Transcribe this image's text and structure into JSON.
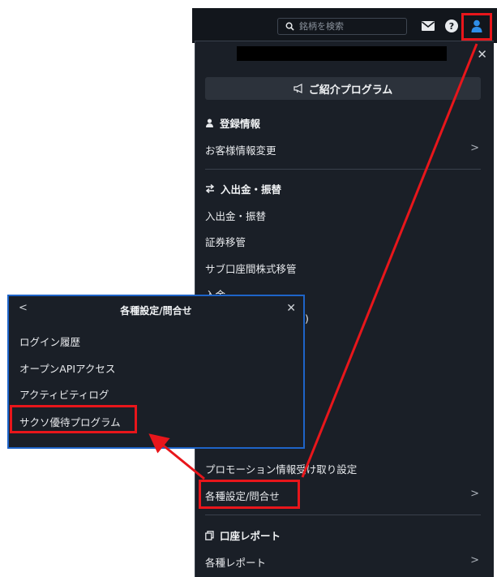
{
  "header": {
    "search_placeholder": "銘柄を検索",
    "icons": [
      "search-icon",
      "mail-icon",
      "help-icon",
      "user-icon"
    ]
  },
  "menu": {
    "promo_button": "ご紹介プログラム",
    "sections": [
      {
        "title": "登録情報",
        "icon": "user-icon",
        "items": [
          "お客様情報変更"
        ]
      },
      {
        "title": "入出金・振替",
        "icon": "transfer-icon",
        "items": [
          "入出金・振替",
          "証券移管",
          "サブ口座間株式移管",
          "入金"
        ]
      }
    ],
    "obscured_text": ")",
    "promotion_item": "プロモーション情報受け取り設定",
    "settings_item": "各種設定/問合せ",
    "report_section": {
      "title": "口座レポート",
      "icon": "copy-icon",
      "items": [
        "各種レポート"
      ]
    }
  },
  "popup": {
    "title": "各種設定/問合せ",
    "items": [
      "ログイン履歴",
      "オープンAPIアクセス",
      "アクティビティログ",
      "サクソ優待プログラム"
    ]
  },
  "colors": {
    "panel_bg": "#1a1f27",
    "topbar_bg": "#12161c",
    "accent_user": "#2f8ee8",
    "annotation_red": "#e8161b",
    "popup_border": "#1e64c8"
  }
}
